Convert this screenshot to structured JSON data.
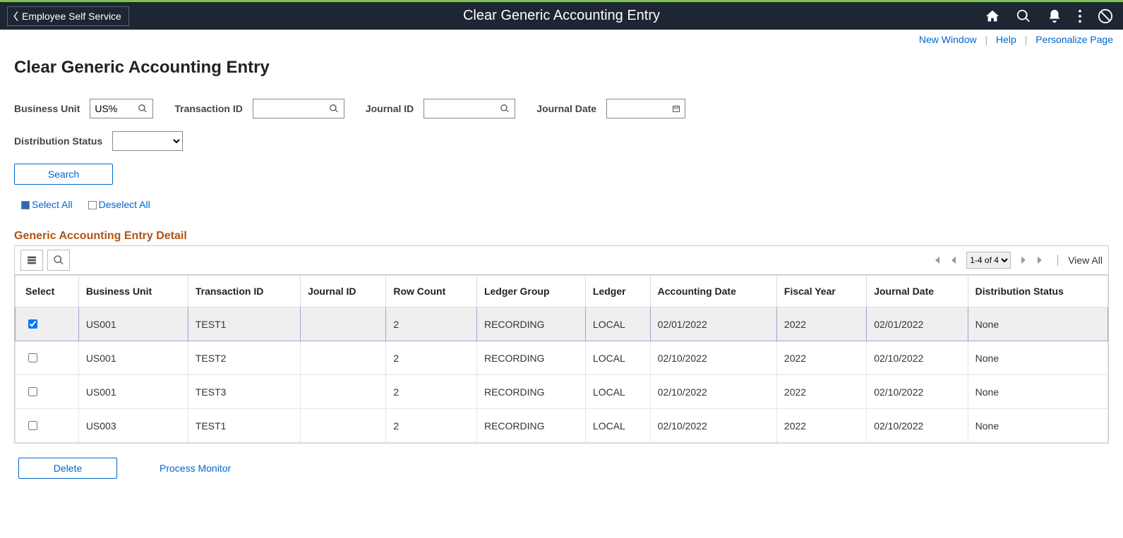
{
  "header": {
    "back_label": "Employee Self Service",
    "title": "Clear Generic Accounting Entry"
  },
  "utility_links": {
    "new_window": "New Window",
    "help": "Help",
    "personalize": "Personalize Page"
  },
  "page_title": "Clear Generic Accounting Entry",
  "search": {
    "business_unit": {
      "label": "Business Unit",
      "value": "US%"
    },
    "transaction_id": {
      "label": "Transaction ID",
      "value": ""
    },
    "journal_id": {
      "label": "Journal ID",
      "value": ""
    },
    "journal_date": {
      "label": "Journal Date",
      "value": ""
    },
    "distribution_status": {
      "label": "Distribution Status",
      "value": ""
    },
    "search_button": "Search",
    "select_all": "Select All",
    "deselect_all": "Deselect All"
  },
  "grid": {
    "section_title": "Generic Accounting Entry Detail",
    "range_display": "1-4 of 4",
    "view_all": "View All",
    "columns": [
      "Select",
      "Business Unit",
      "Transaction ID",
      "Journal ID",
      "Row Count",
      "Ledger Group",
      "Ledger",
      "Accounting Date",
      "Fiscal Year",
      "Journal Date",
      "Distribution Status"
    ],
    "rows": [
      {
        "selected": true,
        "business_unit": "US001",
        "transaction_id": "TEST1",
        "journal_id": "",
        "row_count": "2",
        "ledger_group": "RECORDING",
        "ledger": "LOCAL",
        "accounting_date": "02/01/2022",
        "fiscal_year": "2022",
        "journal_date": "02/01/2022",
        "distribution_status": "None"
      },
      {
        "selected": false,
        "business_unit": "US001",
        "transaction_id": "TEST2",
        "journal_id": "",
        "row_count": "2",
        "ledger_group": "RECORDING",
        "ledger": "LOCAL",
        "accounting_date": "02/10/2022",
        "fiscal_year": "2022",
        "journal_date": "02/10/2022",
        "distribution_status": "None"
      },
      {
        "selected": false,
        "business_unit": "US001",
        "transaction_id": "TEST3",
        "journal_id": "",
        "row_count": "2",
        "ledger_group": "RECORDING",
        "ledger": "LOCAL",
        "accounting_date": "02/10/2022",
        "fiscal_year": "2022",
        "journal_date": "02/10/2022",
        "distribution_status": "None"
      },
      {
        "selected": false,
        "business_unit": "US003",
        "transaction_id": "TEST1",
        "journal_id": "",
        "row_count": "2",
        "ledger_group": "RECORDING",
        "ledger": "LOCAL",
        "accounting_date": "02/10/2022",
        "fiscal_year": "2022",
        "journal_date": "02/10/2022",
        "distribution_status": "None"
      }
    ]
  },
  "actions": {
    "delete": "Delete",
    "process_monitor": "Process Monitor"
  }
}
